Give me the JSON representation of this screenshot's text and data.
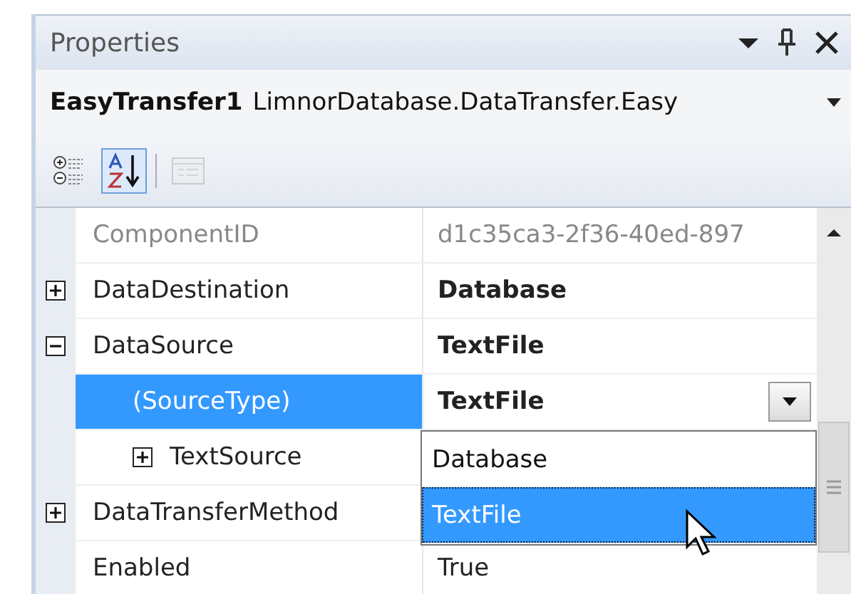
{
  "panel": {
    "title": "Properties"
  },
  "object_selector": {
    "name": "EasyTransfer1",
    "type": "LimnorDatabase.DataTransfer.Easy"
  },
  "toolbar": [
    {
      "kind": "categorized",
      "selected": false,
      "disabled": false
    },
    {
      "kind": "alphabetical",
      "selected": true,
      "disabled": false
    },
    {
      "kind": "property-pages",
      "selected": false,
      "disabled": true
    }
  ],
  "properties": [
    {
      "name": "ComponentID",
      "value": "d1c35ca3-2f36-40ed-897",
      "readonly": true,
      "modified": false,
      "selected": false
    },
    {
      "name": "DataDestination",
      "value": "Database",
      "modified": true,
      "expanded": false,
      "selected": false
    },
    {
      "name": "DataSource",
      "value": "TextFile",
      "modified": true,
      "expanded": true,
      "selected": false,
      "children": [
        {
          "name": "(SourceType)",
          "value": "TextFile",
          "modified": true,
          "selected": true,
          "dropdown": {
            "options": [
              {
                "label": "Database",
                "selected": false
              },
              {
                "label": "TextFile",
                "selected": true
              }
            ]
          }
        },
        {
          "name": "TextSource",
          "expanded": false,
          "selected": false
        }
      ]
    },
    {
      "name": "DataTransferMethod",
      "expanded": false,
      "selected": false
    },
    {
      "name": "Enabled",
      "value": "True",
      "modified": false,
      "selected": false
    }
  ]
}
